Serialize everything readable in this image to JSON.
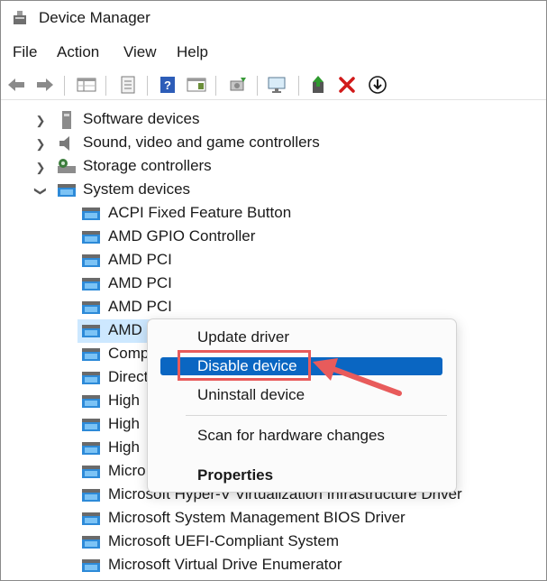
{
  "window": {
    "title": "Device Manager"
  },
  "menu": [
    "File",
    "Action",
    "View",
    "Help"
  ],
  "toolbar": {
    "icons": [
      "back-arrow-icon",
      "forward-arrow-icon",
      "properties-grid-icon",
      "print-icon",
      "help-icon",
      "details-pane-icon",
      "scan-hardware-icon",
      "monitor-icon",
      "update-driver-icon",
      "uninstall-x-icon",
      "download-icon"
    ],
    "colors": {
      "x_red": "#d11a1a",
      "help_blue": "#2d5db8"
    }
  },
  "tree": {
    "categories": [
      {
        "label": "Software devices",
        "icon": "software-devices-icon",
        "expanded": false
      },
      {
        "label": "Sound, video and game controllers",
        "icon": "sound-icon",
        "expanded": false
      },
      {
        "label": "Storage controllers",
        "icon": "storage-icon",
        "expanded": false
      },
      {
        "label": "System devices",
        "icon": "system-folder-icon",
        "expanded": true
      }
    ],
    "children": [
      "ACPI Fixed Feature Button",
      "AMD GPIO Controller",
      "AMD PCI",
      "AMD PCI",
      "AMD PCI",
      "AMD",
      "Comp",
      "Direct",
      "High",
      "High",
      "High",
      "Micro",
      "Microsoft Hyper-V Virtualization Infrastructure Driver",
      "Microsoft System Management BIOS Driver",
      "Microsoft UEFI-Compliant System",
      "Microsoft Virtual Drive Enumerator"
    ]
  },
  "context_menu": {
    "items": [
      "Update driver",
      "Disable device",
      "Uninstall device"
    ],
    "scan": "Scan for hardware changes",
    "properties": "Properties",
    "highlighted": "Disable device",
    "highlight_color": "#0a66c2"
  },
  "annotation": {
    "color": "#e85b5b"
  }
}
